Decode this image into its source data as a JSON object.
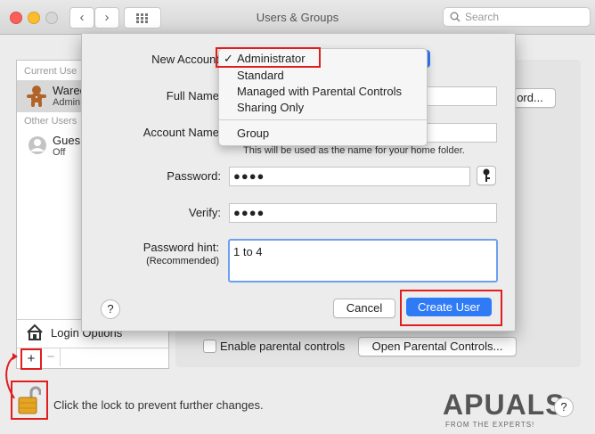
{
  "window": {
    "title": "Users & Groups"
  },
  "search": {
    "placeholder": "Search"
  },
  "sidebar": {
    "current_users_header": "Current Use",
    "current_user": {
      "name": "Wared",
      "role": "Admin"
    },
    "other_users_header": "Other Users",
    "guest_user": {
      "name": "Gues",
      "status": "Off"
    },
    "login_options": "Login Options",
    "add": "+",
    "remove": "−"
  },
  "panel": {
    "password_button": "ord...",
    "enable_parental": "Enable parental controls",
    "open_parental": "Open Parental Controls..."
  },
  "dialog": {
    "new_account_label": "New Account",
    "full_name_label": "Full Name",
    "account_name_label": "Account Name",
    "account_hint": "This will be used as the name for your home folder.",
    "password_label": "Password:",
    "password_value": "●●●●",
    "verify_label": "Verify:",
    "verify_value": "●●●●",
    "hint_label": "Password hint:",
    "hint_sub": "(Recommended)",
    "hint_value": "1 to 4",
    "help": "?",
    "cancel": "Cancel",
    "create": "Create User",
    "menu": {
      "checkmark": "✓",
      "items": [
        "Administrator",
        "Standard",
        "Managed with Parental Controls",
        "Sharing Only",
        "Group"
      ]
    }
  },
  "footer": {
    "lock_text": "Click the lock to prevent further changes.",
    "help": "?"
  },
  "watermark": {
    "text": "APUALS",
    "sub": "FROM THE EXPERTS!"
  },
  "colors": {
    "accent": "#2f7bf5",
    "highlight": "#e01e1e"
  }
}
